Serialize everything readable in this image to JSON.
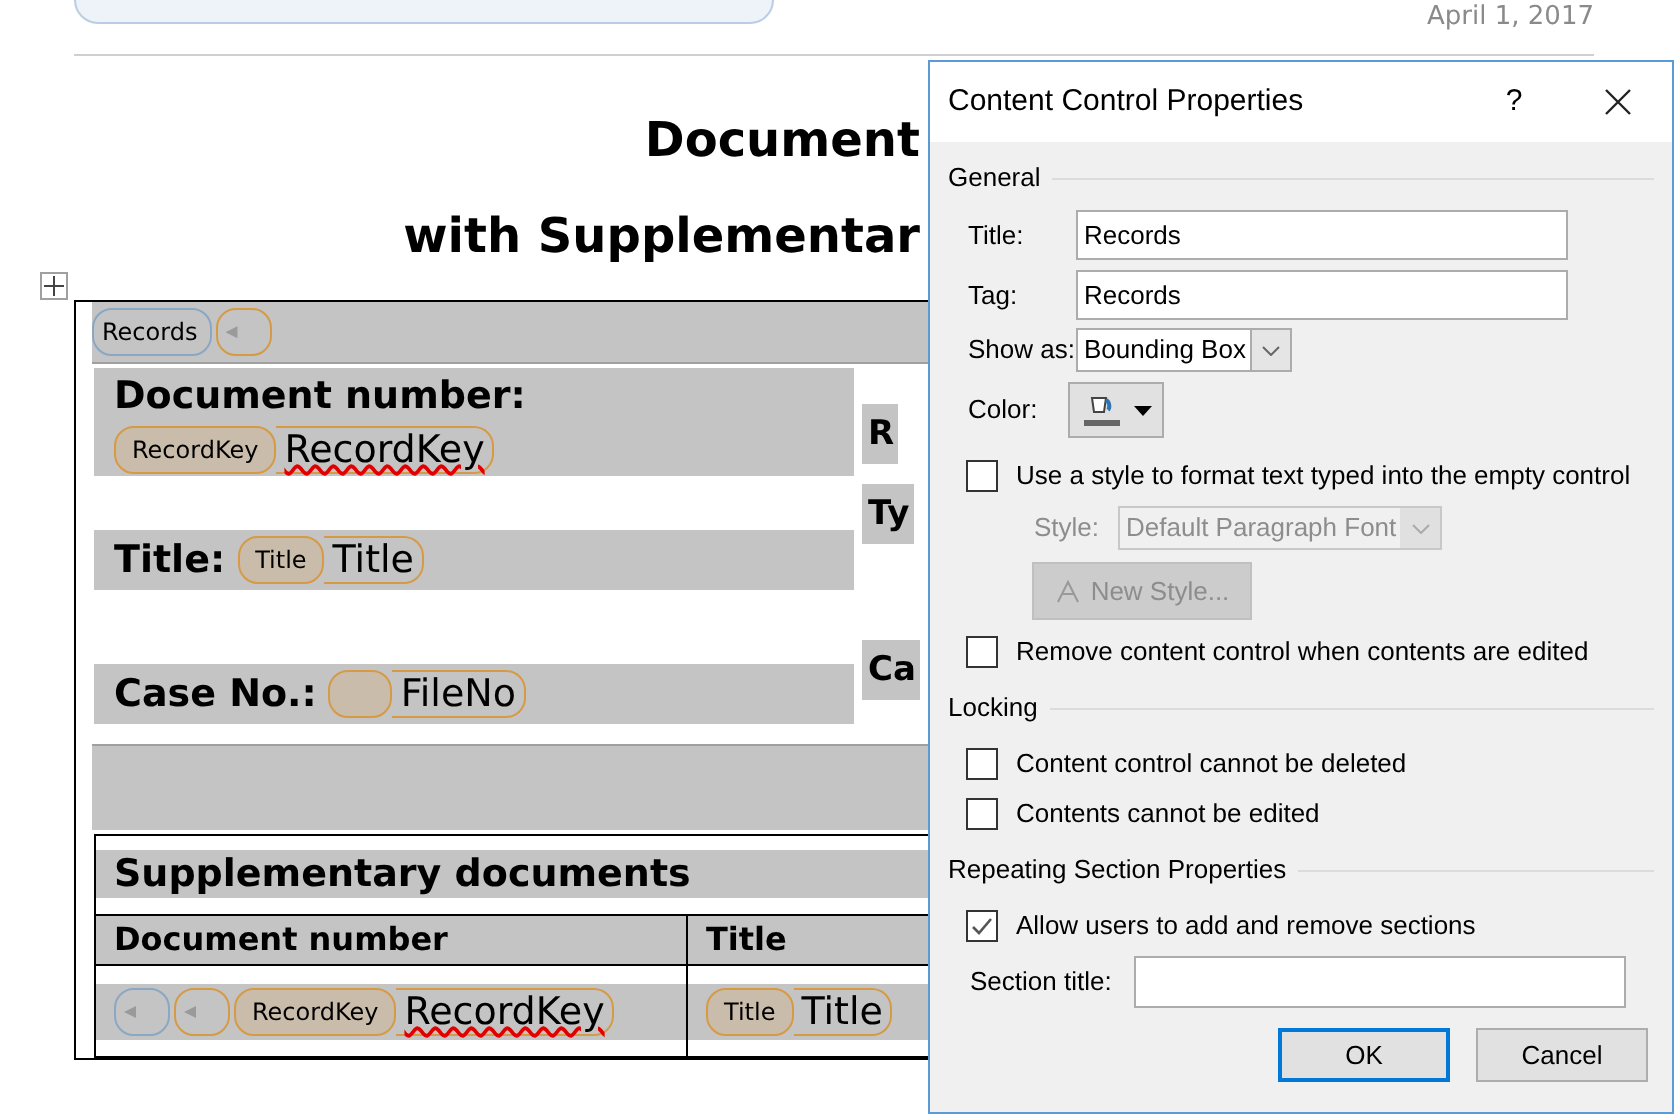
{
  "header": {
    "date": "April 1, 2017"
  },
  "document": {
    "title_lines": [
      "Document",
      "with Supplementar"
    ],
    "repeating_tag": "Records",
    "document_number": {
      "label": "Document number:",
      "tag": "RecordKey",
      "value": "RecordKey",
      "spelling_error": true
    },
    "title_field": {
      "label": "Title:",
      "tag": "Title",
      "value": "Title"
    },
    "case_field": {
      "label": "Case No.:",
      "value": "FileNo"
    },
    "right_column_labels": [
      "R",
      "Ty",
      "Ca"
    ],
    "supplementary": {
      "heading": "Supplementary documents",
      "columns": [
        "Document number",
        "Title"
      ],
      "row": {
        "tag": "RecordKey",
        "value": "RecordKey",
        "spelling_error": true,
        "title_tag": "Title",
        "title_value": "Title"
      }
    }
  },
  "dialog": {
    "title": "Content Control Properties",
    "help": "?",
    "general": {
      "heading": "General",
      "title_label": "Title:",
      "title_value": "Records",
      "tag_label": "Tag:",
      "tag_value": "Records",
      "show_as_label": "Show as:",
      "show_as_value": "Bounding Box",
      "color_label": "Color:",
      "use_style": {
        "label": "Use a style to format text typed into the empty control",
        "checked": false
      },
      "style_label": "Style:",
      "style_value": "Default Paragraph Font",
      "style_disabled": true,
      "new_style_button": "New Style...",
      "remove": {
        "label": "Remove content control when contents are edited",
        "checked": false
      }
    },
    "locking": {
      "heading": "Locking",
      "options": [
        {
          "label": "Content control cannot be deleted",
          "checked": false
        },
        {
          "label": "Contents cannot be edited",
          "checked": false
        }
      ]
    },
    "repeating": {
      "heading": "Repeating Section Properties",
      "allow": {
        "label": "Allow users to add and remove sections",
        "checked": true
      },
      "section_title_label": "Section title:"
    },
    "buttons": [
      {
        "label": "OK",
        "default": true
      },
      {
        "label": "Cancel",
        "default": false
      }
    ]
  }
}
